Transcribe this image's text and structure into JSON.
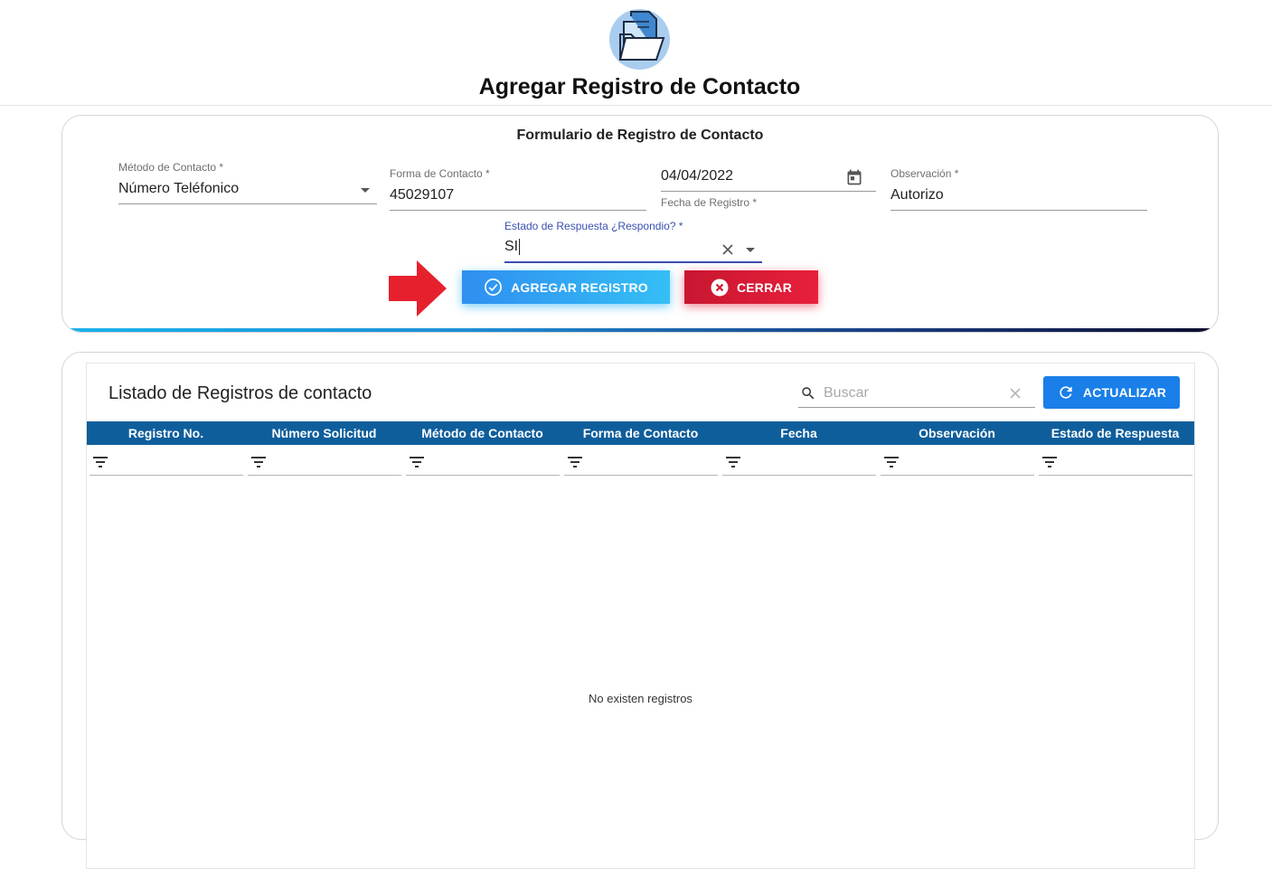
{
  "header": {
    "title": "Agregar Registro de Contacto",
    "icon": "folder-document-icon"
  },
  "form": {
    "title": "Formulario de Registro de Contacto",
    "metodo": {
      "label": "Método de Contacto *",
      "value": "Número Teléfonico"
    },
    "forma": {
      "label": "Forma de Contacto *",
      "value": "45029107"
    },
    "fecha": {
      "label": "Fecha de Registro *",
      "value": "04/04/2022"
    },
    "observacion": {
      "label": "Observación *",
      "value": "Autorizo"
    },
    "estado": {
      "label": "Estado de Respuesta ¿Respondio? *",
      "value": "SI"
    },
    "add_label": "AGREGAR REGISTRO",
    "close_label": "CERRAR"
  },
  "list": {
    "title": "Listado de Registros de contacto",
    "search_placeholder": "Buscar",
    "refresh_label": "ACTUALIZAR",
    "columns": [
      "Registro No.",
      "Número Solicitud",
      "Método de Contacto",
      "Forma de Contacto",
      "Fecha",
      "Observación",
      "Estado de Respuesta"
    ],
    "empty_message": "No existen registros"
  },
  "colors": {
    "accent_blue": "#1a7fe8",
    "header_blue": "#0f5e9c",
    "add_gradient_start": "#2f8ff0",
    "close_red": "#e8203c",
    "arrow_red": "#e6202d",
    "focus_label": "#3a4fb0"
  }
}
